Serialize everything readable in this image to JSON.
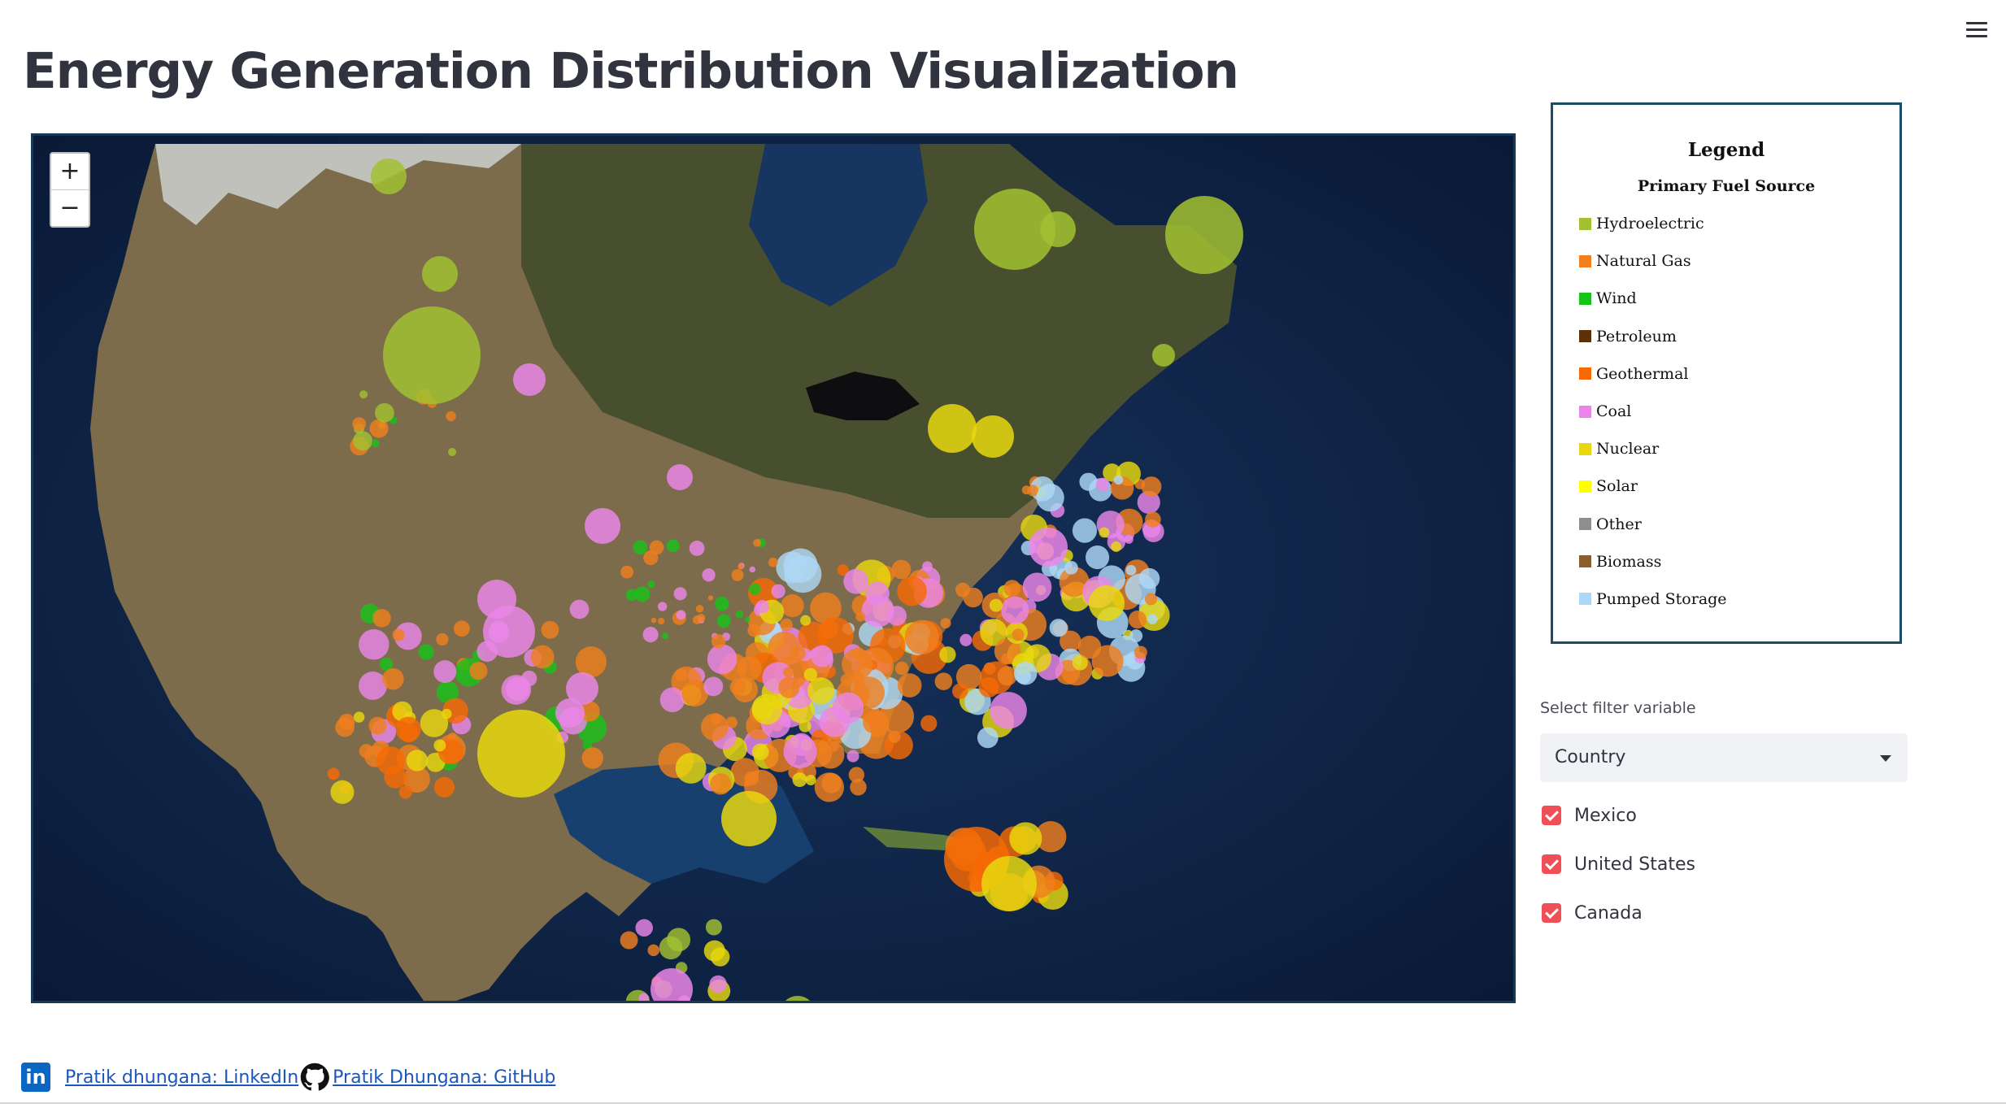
{
  "header": {
    "title": "Energy Generation Distribution Visualization"
  },
  "map": {
    "zoom_in_label": "+",
    "zoom_out_label": "−",
    "ocean_color": "#0d2447",
    "land_color": "#8a7a57"
  },
  "legend": {
    "title": "Legend",
    "subtitle": "Primary Fuel Source",
    "items": [
      {
        "label": "Hydroelectric",
        "color": "#a2c131"
      },
      {
        "label": "Natural Gas",
        "color": "#ef7f1f"
      },
      {
        "label": "Wind",
        "color": "#19c21a"
      },
      {
        "label": "Petroleum",
        "color": "#5b3208"
      },
      {
        "label": "Geothermal",
        "color": "#f56a05"
      },
      {
        "label": "Coal",
        "color": "#ea86e8"
      },
      {
        "label": "Nuclear",
        "color": "#e8d80f"
      },
      {
        "label": "Solar",
        "color": "#ffff00"
      },
      {
        "label": "Other",
        "color": "#8e8e8e"
      },
      {
        "label": "Biomass",
        "color": "#8b5e2e"
      },
      {
        "label": "Pumped Storage",
        "color": "#add8f5"
      }
    ]
  },
  "filter": {
    "label": "Select filter variable",
    "selected": "Country",
    "options": [
      {
        "label": "Mexico",
        "checked": true
      },
      {
        "label": "United States",
        "checked": true
      },
      {
        "label": "Canada",
        "checked": true
      }
    ]
  },
  "footer": {
    "linkedin_text": "Pratik dhungana: LinkedIn",
    "github_text": "Pratik Dhungana: GitHub",
    "linkedin_icon": "linkedin-icon",
    "github_icon": "github-icon"
  }
}
